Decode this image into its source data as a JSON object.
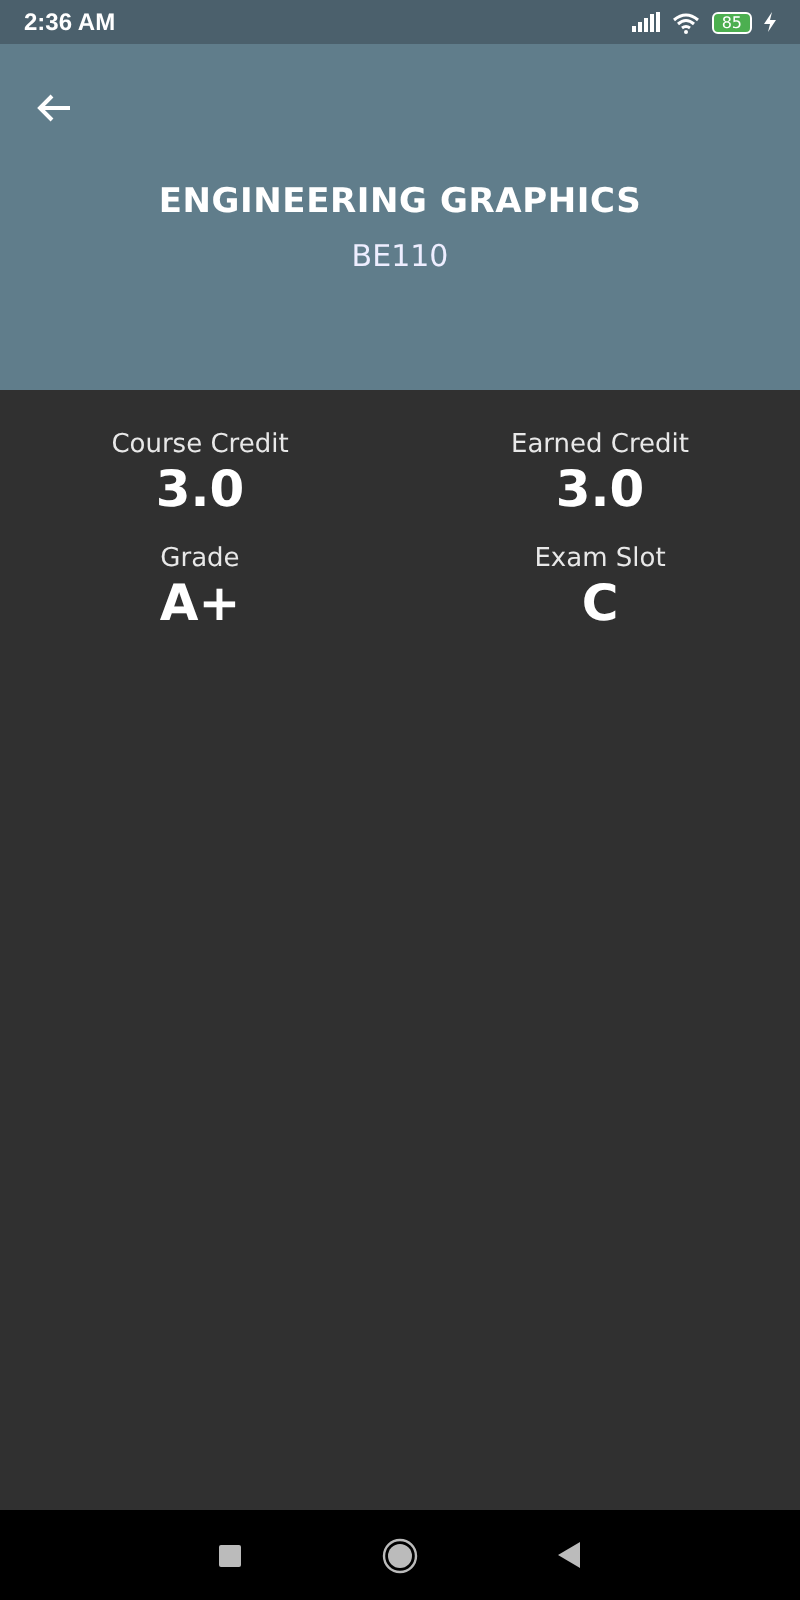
{
  "status_bar": {
    "time": "2:36 AM",
    "battery": "85"
  },
  "header": {
    "title": "ENGINEERING GRAPHICS",
    "code": "BE110"
  },
  "stats": [
    {
      "label": "Course Credit",
      "value": "3.0"
    },
    {
      "label": "Earned Credit",
      "value": "3.0"
    },
    {
      "label": "Grade",
      "value": "A+"
    },
    {
      "label": "Exam Slot",
      "value": "C"
    }
  ]
}
